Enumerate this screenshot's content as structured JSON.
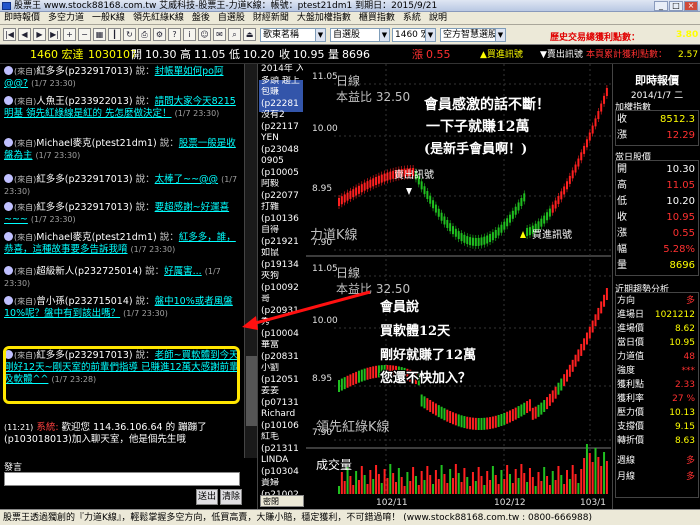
{
  "titlebar": {
    "title": "股票王 www.stock88168.com.tw 艾威科技-股票王-力道K線：帳號：ptest21dm1 到期日：2015/9/21"
  },
  "menu": [
    "即時報價",
    "多空力道",
    "一般K線",
    "領先紅綠K線",
    "盤後",
    "自選股",
    "財經新聞",
    "大盤加權指數",
    "櫃買指數",
    "系統",
    "說明"
  ],
  "toolbar": {
    "stock_select": "歌東茗稱",
    "group_select": "自選股",
    "period_select": "1460 宏達",
    "strategy_select": "空方智慧選股",
    "history_note": "歷史交易總獲利點數：",
    "history_value": "3.80"
  },
  "quote": {
    "symbol": "1460 宏達",
    "date": "1030107",
    "open_label": "開",
    "open": "10.30",
    "high_label": "高",
    "high": "11.05",
    "low_label": "低",
    "low": "10.20",
    "close_label": "收",
    "close": "10.95",
    "vol_label": "量",
    "vol": "8696",
    "change_label": "漲",
    "change": "0.55",
    "buy_signal": "▲買進訊號",
    "sell_signal": "▼賣出訊號",
    "accuracy_label": "本頁累計獲利點數：",
    "accuracy_value": "2.57"
  },
  "chat": {
    "messages": [
      {
        "tag": "(來自)",
        "name": "紅多多",
        "uid": "(p232917013)",
        "sep": " 說：",
        "text": "封帳單如何po阿@@?",
        "time": "(1/7 23:30)"
      },
      {
        "tag": "(來自)",
        "name": "人魚王",
        "uid": "(p233922013)",
        "sep": " 說：",
        "text": "請問大家今天8215 明基 領先紅綠線是紅的 先怎麼做決定！",
        "time": "(1/7 23:30)"
      },
      {
        "tag": "(來自)",
        "name": "Michael麥克",
        "uid": "(ptest21dm1)",
        "sep": " 說：",
        "text": "股票一般是收盤為主",
        "time": "(1/7 23:30)"
      },
      {
        "tag": "(來自)",
        "name": "紅多多",
        "uid": "(p232917013)",
        "sep": " 說：",
        "text": "太棒了~~@@",
        "time": "(1/7 23:30)"
      },
      {
        "tag": "(來自)",
        "name": "紅多多",
        "uid": "(p232917013)",
        "sep": " 說：",
        "text": "要超感謝~好運喜~~~",
        "time": "(1/7 23:30)"
      },
      {
        "tag": "(來自)",
        "name": "Michael麥克",
        "uid": "(ptest21dm1)",
        "sep": " 說：",
        "text": "紅多多，誰，恭喜，這種故事要多告訴我唷",
        "time": "(1/7 23:30)"
      },
      {
        "tag": "(來自)",
        "name": "超級新人",
        "uid": "(p232725014)",
        "sep": " 說：",
        "text": "好厲害...",
        "time": "(1/7 23:30)"
      },
      {
        "tag": "(來自)",
        "name": "曾小孫",
        "uid": "(p232715014)",
        "sep": " 說：",
        "text": "盤中10%或者風盤10%呢？盤中有到該出嗎？",
        "time": "(1/7 23:30)"
      },
      {
        "tag": "(來自)",
        "name": "紅多多",
        "uid": "(p232917013)",
        "sep": " 說：",
        "text": "老師~買軟體到今天剛好12天~剛天室的前輩們指導 已賺進12萬大感謝前輩及軟體^^",
        "time": "(1/7 23:28)"
      },
      {
        "tag": "",
        "name": "",
        "uid": "",
        "sep": "",
        "text": "",
        "time": ""
      },
      {
        "tag": "(11:21)",
        "name": "系統:",
        "uid": "",
        "sep": " 歡迎您 114.36.106.64 的 ",
        "text": "蹦蹦了(p103018013)加入聊天室，他是個先生哦",
        "time": ""
      }
    ],
    "input_label": "發言",
    "send_button": "送出",
    "clear_button": "清除"
  },
  "userlist": {
    "items": [
      "2014年 入會",
      "多頭 趨上",
      "包賺",
      "(p22281",
      "沒有2",
      "(p22117",
      "YEN",
      "(p23048",
      "0905",
      "(p10005",
      "阿毅",
      "(p22077",
      "打雜",
      "(p10136",
      "自得",
      "(p21921",
      "如鼠",
      "(p19134",
      "夾狗",
      "(p10092",
      "哥",
      "(p20931",
      "秀",
      "(p10004",
      "華富",
      "(p20831",
      "小劉",
      "(p12051",
      "姜姜",
      "(p07131",
      "Richard",
      "(p10106",
      "紅毛",
      "(p21311",
      "LINDA",
      "(p10304",
      "貴婦",
      "(p21002"
    ],
    "scroll_label": "密閉"
  },
  "charts": {
    "top_label": "日線",
    "top_indicator": "本益比 32.50",
    "top_name": "力道K線",
    "top_sell_signal": "賣出訊號",
    "top_buy_signal": "買進訊號",
    "mid_label": "日線",
    "mid_indicator": "本益比 32.50",
    "mid_name": "領先紅綠K線",
    "vol_title": "成交量",
    "y_top": "11.05",
    "y_mid": "10.00",
    "y_low": "8.95",
    "y_bot": "7.90",
    "x_labels": [
      "102/11",
      "102/12",
      "103/1"
    ],
    "callout1_line1": "會員感激的話不斷！",
    "callout1_line2": "一下子就賺12萬",
    "callout1_line3": "(是新手會員啊！)",
    "callout2_line1": "會員說",
    "callout2_line2": "買軟體12天",
    "callout2_line3": "剛好就賺了12萬",
    "callout2_line4": "您還不快加入？",
    "up_color": "#ff2020",
    "down_color": "#20c020"
  },
  "panel": {
    "title": "即時報價",
    "date": "2014/1/7 二",
    "index_head": "加權指數",
    "index_close_label": "收",
    "index_close": "8512.3",
    "index_change_label": "漲",
    "index_change": "12.29",
    "day_head": "當日股價",
    "open_label": "開",
    "open": "10.30",
    "high_label": "高",
    "high": "11.05",
    "low_label": "低",
    "low": "10.20",
    "close_label": "收",
    "close": "10.95",
    "change_label": "漲",
    "change": "0.55",
    "pct_label": "幅",
    "pct": "5.28%",
    "vol_label": "量",
    "vol": "8696",
    "trend_head": "近期趨勢分析",
    "direction_label": "方向",
    "direction": "多",
    "entry_date_label": "進場日",
    "entry_date": "1021212",
    "entry_price_label": "進場價",
    "entry_price": "8.62",
    "current_label": "當日價",
    "current": "10.95",
    "force_label": "力道值",
    "force": "48",
    "strength_label": "強度",
    "strength": "***",
    "profit_label": "獲利點",
    "profit": "2.33",
    "profit_pct_label": "獲利率",
    "profit_pct": "27 %",
    "pressure_label": "壓力價",
    "pressure": "10.13",
    "support_label": "支撐價",
    "support": "9.15",
    "turn_label": "轉折價",
    "turn": "8.63",
    "week_label": "週線",
    "week": "多",
    "month_label": "月線",
    "month": "多"
  },
  "statusbar": {
    "text": "股票王透過獨創的『力道K線』，輕鬆掌握多空方向，低買高賣，大賺小賠，穩定獲利，不可錯過唷！ (www.stock88168.com.tw : 0800-666988)"
  }
}
